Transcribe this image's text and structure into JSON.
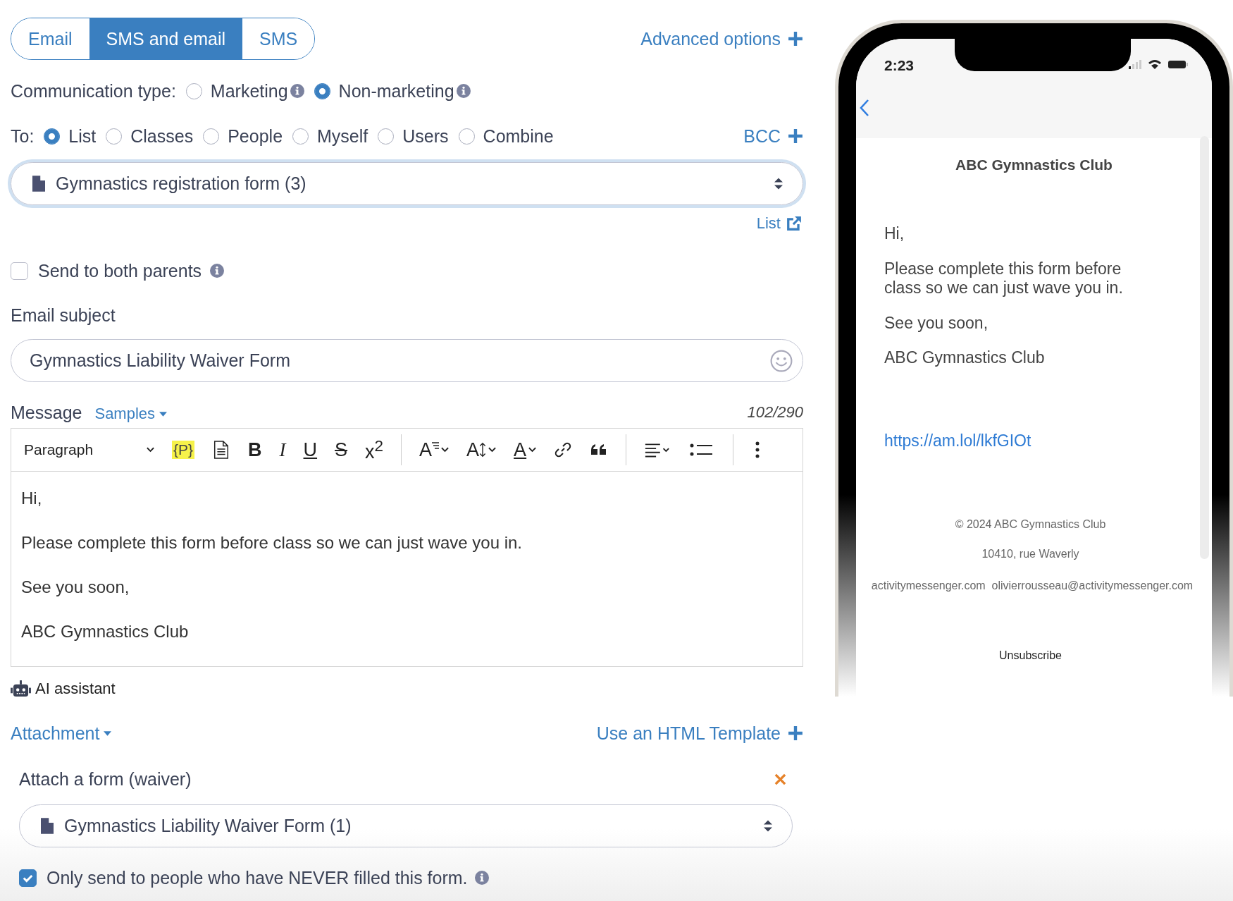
{
  "channel_tabs": [
    {
      "label": "Email",
      "selected": false
    },
    {
      "label": "SMS and email",
      "selected": true
    },
    {
      "label": "SMS",
      "selected": false
    }
  ],
  "advanced_options": "Advanced options",
  "communication_type": {
    "label": "Communication type:",
    "options": [
      {
        "label": "Marketing",
        "selected": false
      },
      {
        "label": "Non-marketing",
        "selected": true
      }
    ]
  },
  "recipients": {
    "label": "To:",
    "options": [
      {
        "label": "List",
        "selected": true
      },
      {
        "label": "Classes",
        "selected": false
      },
      {
        "label": "People",
        "selected": false
      },
      {
        "label": "Myself",
        "selected": false
      },
      {
        "label": "Users",
        "selected": false
      },
      {
        "label": "Combine",
        "selected": false
      }
    ]
  },
  "bcc": "BCC",
  "list_select": {
    "value": "Gymnastics registration form (3)"
  },
  "list_link": "List",
  "send_to_both_parents": {
    "label": "Send to both parents",
    "checked": false
  },
  "email_subject": {
    "label": "Email subject",
    "value": "Gymnastics Liability Waiver Form"
  },
  "message": {
    "label": "Message",
    "samples": "Samples",
    "counter": "102/290",
    "toolbar": [
      {
        "kind": "dropdown",
        "label": "Paragraph"
      },
      {
        "kind": "tag",
        "label": "{P}"
      },
      {
        "kind": "document"
      },
      {
        "kind": "bold",
        "label": "B"
      },
      {
        "kind": "italic",
        "label": "I"
      },
      {
        "kind": "underline",
        "label": "U"
      },
      {
        "kind": "strike",
        "label": "S"
      },
      {
        "kind": "superscript",
        "label": "x$^{2}$"
      },
      {
        "kind": "separator"
      },
      {
        "kind": "font-style",
        "label": "A"
      },
      {
        "kind": "font-size",
        "label": "A"
      },
      {
        "kind": "font-color",
        "label": "A"
      },
      {
        "kind": "link"
      },
      {
        "kind": "quote"
      },
      {
        "kind": "separator"
      },
      {
        "kind": "align"
      },
      {
        "kind": "list"
      },
      {
        "kind": "separator"
      },
      {
        "kind": "more"
      }
    ],
    "paragraphs": [
      "Hi,",
      "Please complete this form before class so we can just wave you in.",
      "See you soon,",
      "ABC Gymnastics Club"
    ]
  },
  "ai_assistant": "AI assistant",
  "attachment": "Attachment",
  "html_template": "Use an HTML Template",
  "attach_form": {
    "label": "Attach a form (waiver)",
    "value": "Gymnastics Liability Waiver Form (1)"
  },
  "only_never_filled": {
    "label": "Only send to people who have NEVER filled this form.",
    "checked": true
  },
  "phone_preview": {
    "time": "2:23",
    "heading": "ABC Gymnastics Club",
    "paragraphs": [
      "Hi,",
      "Please complete this form before class so we can just wave you in.",
      "See you soon,",
      "ABC Gymnastics Club"
    ],
    "link": "https://am.lol/lkfGIOt",
    "copyright": "© 2024 ABC Gymnastics Club",
    "address": "10410, rue Waverly",
    "website": "activitymessenger.com",
    "email": "olivierrousseau@activitymessenger.com",
    "unsubscribe": "Unsubscribe"
  }
}
